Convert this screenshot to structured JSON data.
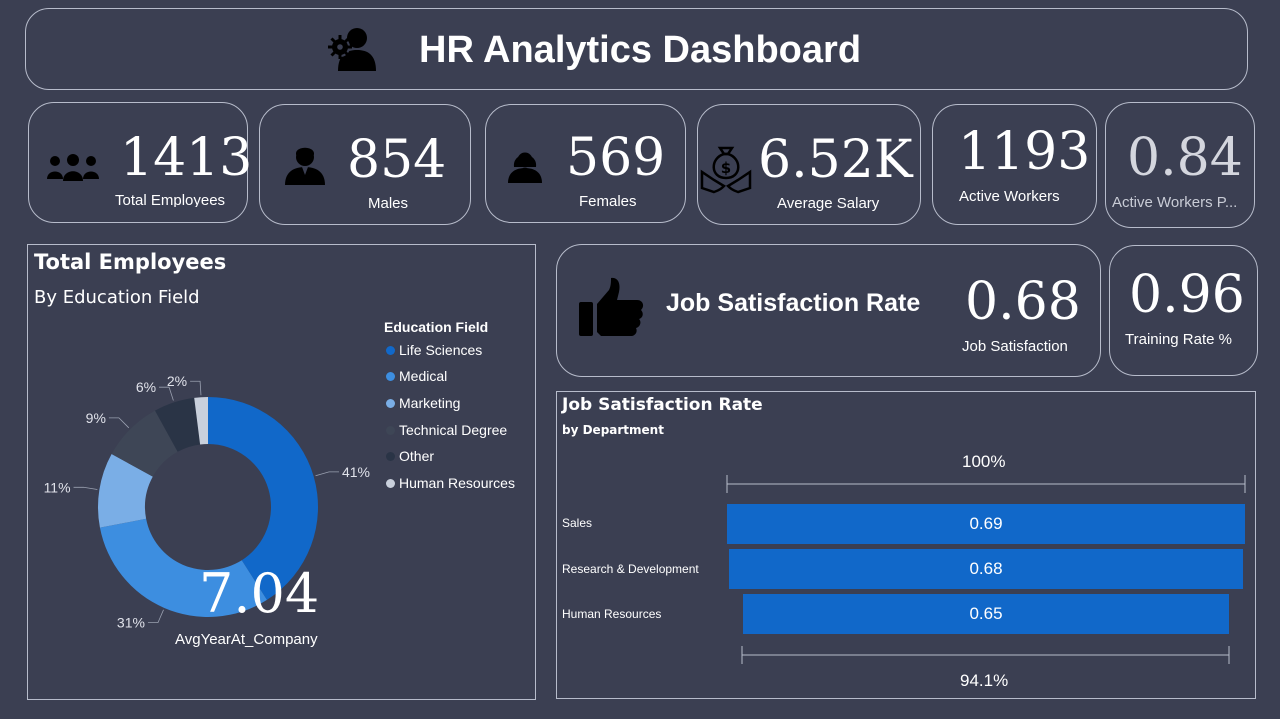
{
  "header": {
    "title": "HR Analytics Dashboard",
    "icon": "hr-person-gear-icon"
  },
  "kpis": {
    "total_employees": {
      "value": "1413",
      "label": "Total Employees",
      "icon": "people-group-icon"
    },
    "males": {
      "value": "854",
      "label": "Males",
      "icon": "male-avatar-icon"
    },
    "females": {
      "value": "569",
      "label": "Females",
      "icon": "female-avatar-icon"
    },
    "average_salary": {
      "value": "6.52K",
      "label": "Average Salary",
      "icon": "money-bag-hands-icon"
    },
    "active_workers": {
      "value": "1193",
      "label": "Active Workers"
    },
    "active_workers_pct": {
      "value": "0.84",
      "label": "Active Workers P..."
    }
  },
  "job_satisfaction_card": {
    "title": "Job Satisfaction Rate",
    "value": "0.68",
    "label": "Job Satisfaction",
    "icon": "thumbs-up-icon"
  },
  "training_card": {
    "value": "0.96",
    "label": "Training Rate %"
  },
  "donut_panel": {
    "title": "Total Employees",
    "subtitle": "By Education Field",
    "legend_title": "Education Field",
    "center_value": "7.04",
    "center_label": "AvgYearAt_Company"
  },
  "bar_panel": {
    "title": "Job Satisfaction Rate",
    "subtitle": "by Department",
    "top_ref_label": "100%",
    "bottom_ref_label": "94.1%"
  },
  "colors": {
    "background": "#3b3f52",
    "accent": "#1168c9",
    "border": "#b7bccb"
  },
  "chart_data": [
    {
      "type": "pie",
      "categories": [
        "Life Sciences",
        "Medical",
        "Marketing",
        "Technical Degree",
        "Other",
        "Human Resources"
      ],
      "values": [
        41,
        31,
        11,
        9,
        6,
        2
      ],
      "value_labels": [
        "41%",
        "31%",
        "11%",
        "9%",
        "6%",
        "2%"
      ],
      "colors": [
        "#1168c9",
        "#3d8ee0",
        "#7aaee6",
        "#3e4656",
        "#2a3446",
        "#c9d0dc"
      ],
      "title": "Total Employees",
      "subtitle": "By Education Field",
      "legend_title": "Education Field",
      "legend_position": "top-right"
    },
    {
      "type": "bar",
      "categories": [
        "Sales",
        "Research & Development",
        "Human Resources"
      ],
      "values": [
        0.69,
        0.68,
        0.65
      ],
      "value_labels": [
        "0.69",
        "0.68",
        "0.65"
      ],
      "title": "Job Satisfaction Rate",
      "subtitle": "by Department",
      "orientation": "horizontal"
    }
  ]
}
